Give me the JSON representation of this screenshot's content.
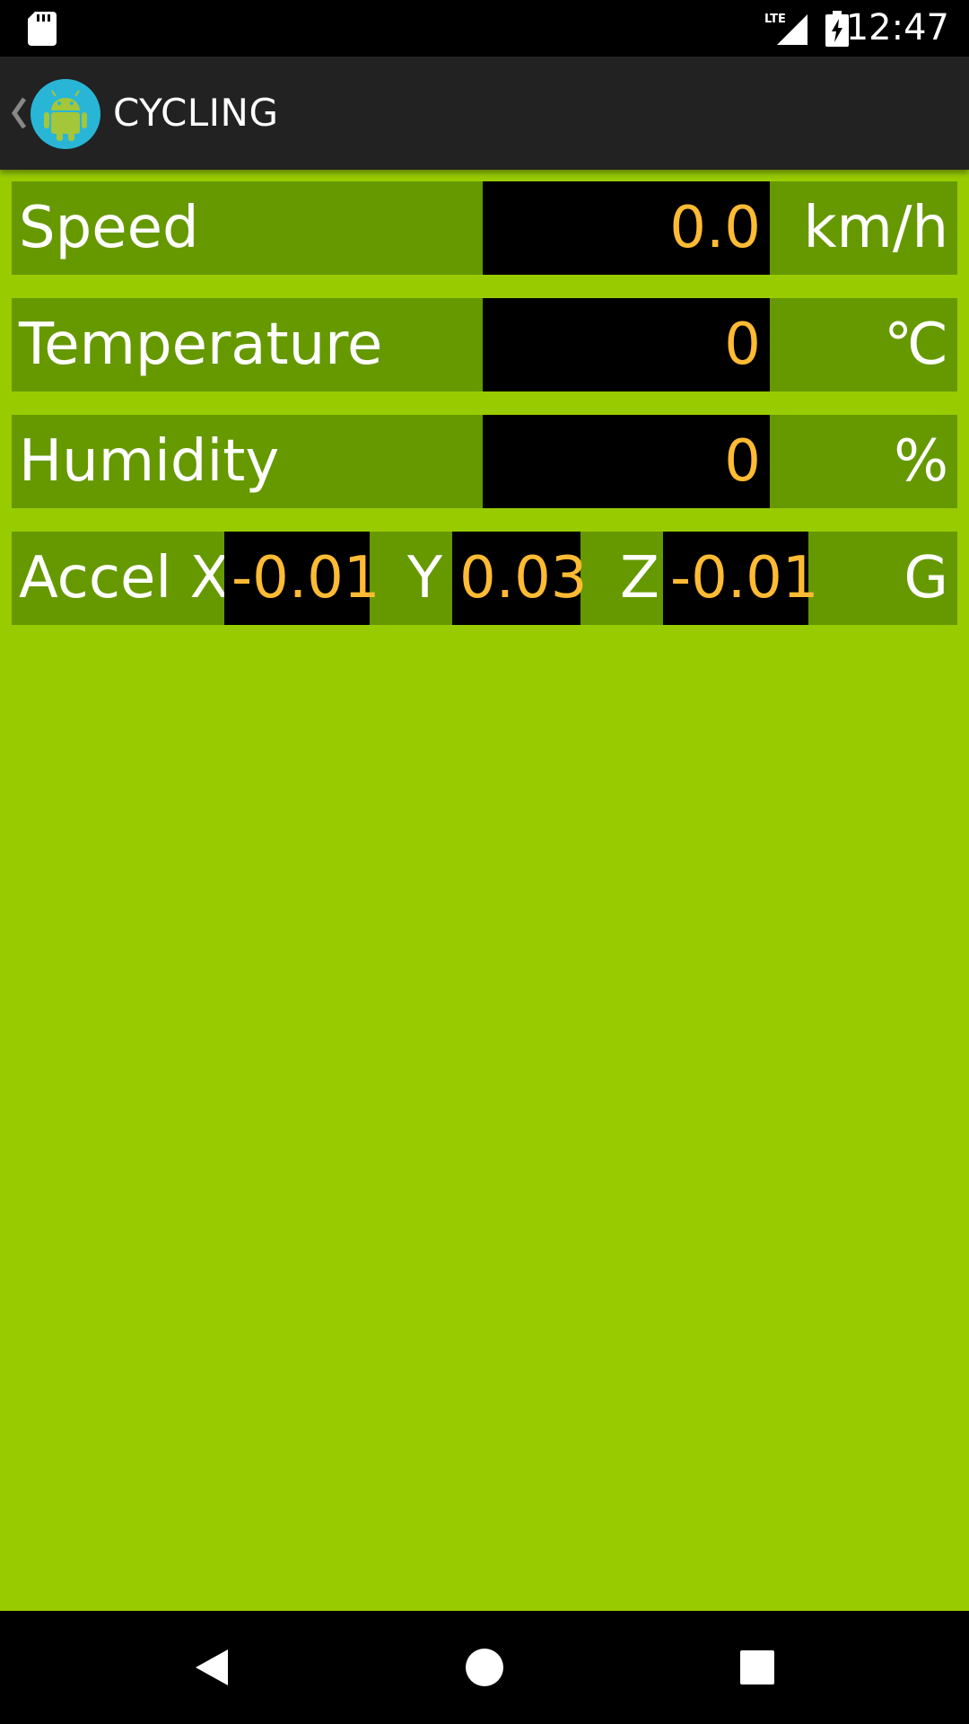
{
  "status_bar": {
    "time": "12:47",
    "icons": [
      "sd-card-icon",
      "lte-signal-icon",
      "battery-charging-icon"
    ],
    "network": "LTE"
  },
  "action_bar": {
    "title": "CYCLING",
    "icons": [
      "back-chevron-icon",
      "android-app-icon"
    ]
  },
  "rows": {
    "speed": {
      "label": "Speed",
      "value": "0.0",
      "unit": "km/h"
    },
    "temperature": {
      "label": "Temperature",
      "value": "0",
      "unit": "℃"
    },
    "humidity": {
      "label": "Humidity",
      "value": "0",
      "unit": "%"
    },
    "accel": {
      "label": "Accel X",
      "x": "-0.01",
      "y_label": "Y",
      "y": "0.03",
      "z_label": "Z",
      "z": "-0.01",
      "unit": "G"
    }
  },
  "nav_bar": {
    "icons": [
      "back-triangle-icon",
      "home-circle-icon",
      "recents-square-icon"
    ]
  },
  "colors": {
    "background": "#99cc00",
    "row_background": "#669900",
    "value_text": "#ffbb33",
    "value_box": "#000000",
    "action_bar": "#222222"
  }
}
